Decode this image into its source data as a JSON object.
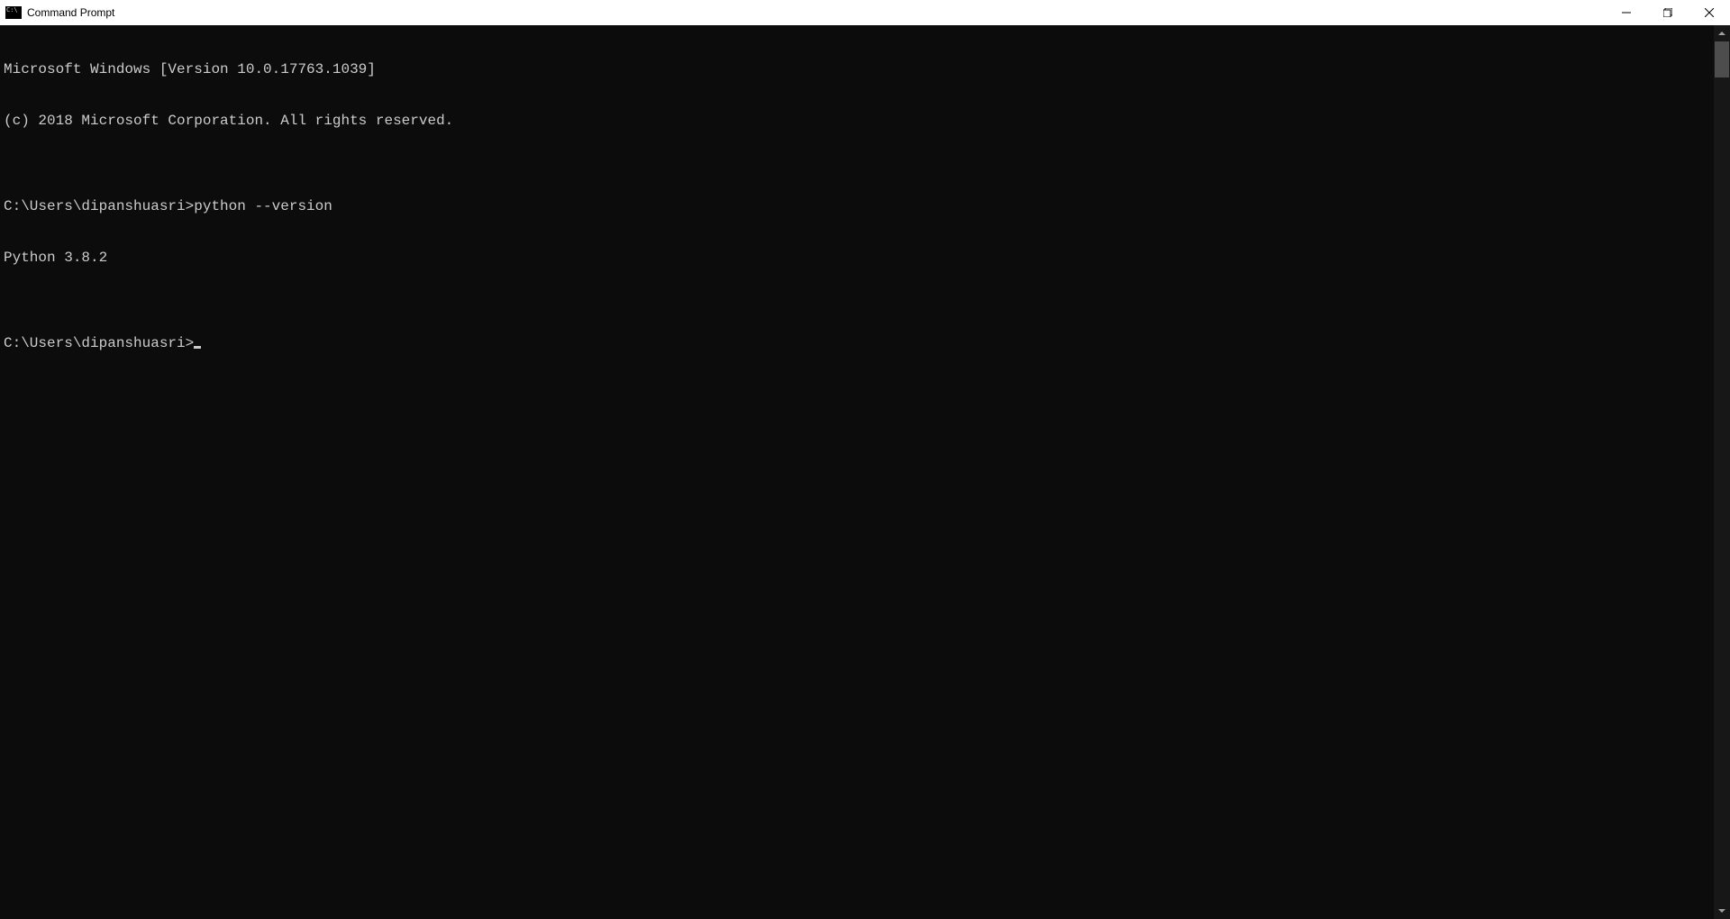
{
  "titlebar": {
    "title": "Command Prompt"
  },
  "terminal": {
    "line1": "Microsoft Windows [Version 10.0.17763.1039]",
    "line2": "(c) 2018 Microsoft Corporation. All rights reserved.",
    "blank1": "",
    "prompt1": "C:\\Users\\dipanshuasri>",
    "command1": "python --version",
    "output1": "Python 3.8.2",
    "blank2": "",
    "prompt2": "C:\\Users\\dipanshuasri>"
  }
}
